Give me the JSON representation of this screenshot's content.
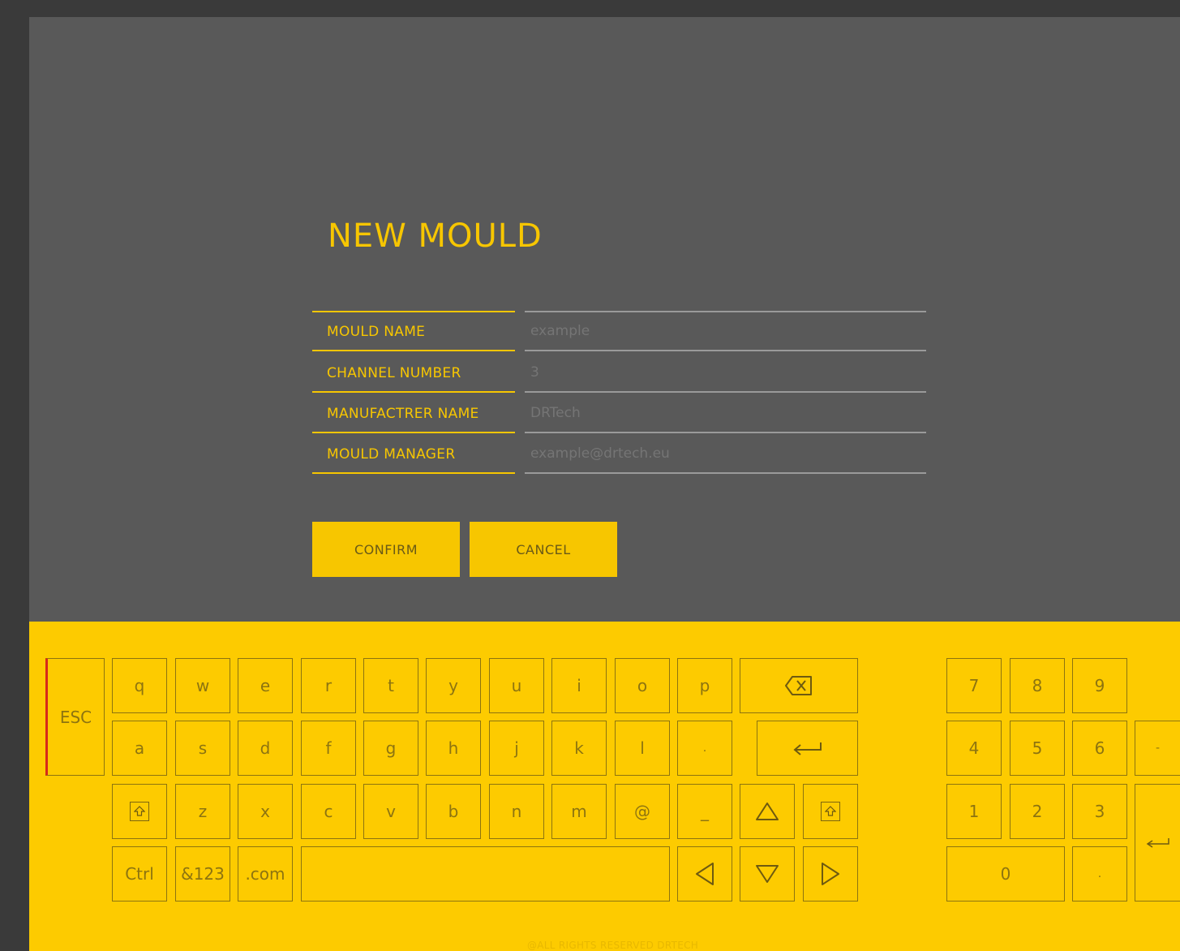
{
  "form": {
    "title": "NEW MOULD",
    "fields": [
      {
        "label": "MOULD NAME",
        "placeholder": "example"
      },
      {
        "label": "CHANNEL NUMBER",
        "placeholder": "3"
      },
      {
        "label": "MANUFACTRER NAME",
        "placeholder": "DRTech"
      },
      {
        "label": "MOULD MANAGER",
        "placeholder": "example@drtech.eu"
      }
    ],
    "confirm_label": "CONFIRM",
    "cancel_label": "CANCEL"
  },
  "keyboard": {
    "esc": "ESC",
    "row1": [
      "q",
      "w",
      "e",
      "r",
      "t",
      "y",
      "u",
      "i",
      "o",
      "p"
    ],
    "row2": [
      "a",
      "s",
      "d",
      "f",
      "g",
      "h",
      "j",
      "k",
      "l",
      "."
    ],
    "row3": [
      "z",
      "x",
      "c",
      "v",
      "b",
      "n",
      "m",
      "@",
      "_"
    ],
    "ctrl": "Ctrl",
    "symbols": "&123",
    "dotcom": ".com",
    "numpad": {
      "row1": [
        "7",
        "8",
        "9"
      ],
      "row2": [
        "4",
        "5",
        "6",
        "-"
      ],
      "row3": [
        "1",
        "2",
        "3"
      ],
      "zero": "0",
      "dot": "."
    },
    "icons": {
      "backspace": "backspace-icon",
      "enter": "enter-icon",
      "shift": "shift-icon",
      "up": "arrow-up-icon",
      "down": "arrow-down-icon",
      "left": "arrow-left-icon",
      "right": "arrow-right-icon"
    }
  },
  "footer": {
    "text": "@ALL RIGHTS RESERVED DRTECH"
  },
  "colors": {
    "accent": "#fdcb00",
    "panel": "#595959",
    "background": "#3a3a3a",
    "esc_marker": "#d62a1a"
  }
}
